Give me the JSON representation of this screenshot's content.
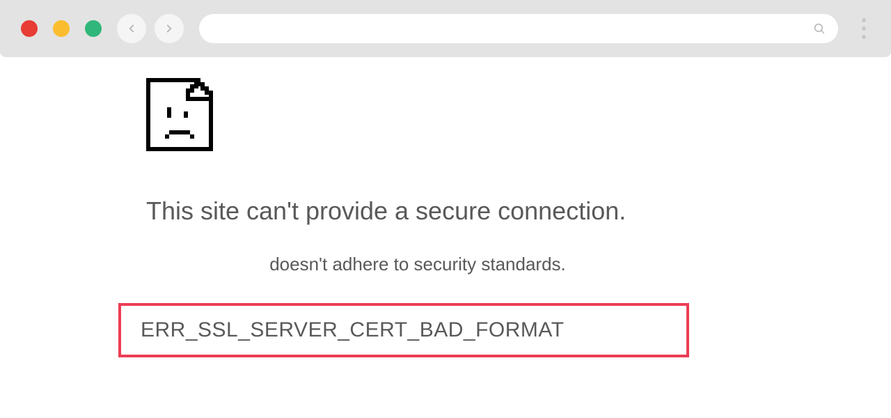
{
  "browser": {
    "traffic_lights": [
      "close",
      "minimize",
      "maximize"
    ],
    "nav": {
      "back": "back",
      "forward": "forward"
    },
    "address_value": "",
    "search_icon": "search",
    "menu": "menu"
  },
  "error": {
    "heading": "This site can't provide a secure connection.",
    "subheading": "doesn't adhere  to security standards.",
    "code": "ERR_SSL_SERVER_CERT_BAD_FORMAT"
  }
}
